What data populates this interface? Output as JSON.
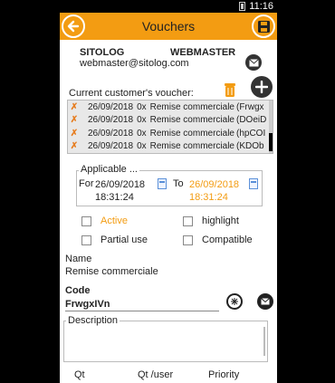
{
  "status": {
    "time": "11:16"
  },
  "header": {
    "title": "Vouchers"
  },
  "user": {
    "company": "SITOLOG",
    "role": "WEBMASTER",
    "email": "webmaster@sitolog.com"
  },
  "vouchers": {
    "label": "Current customer's voucher:",
    "items": [
      {
        "date": "26/09/2018",
        "qty": "0x",
        "name": "Remise commerciale",
        "code": "(Frwgx"
      },
      {
        "date": "26/09/2018",
        "qty": "0x",
        "name": "Remise commerciale",
        "code": "(DOeiD"
      },
      {
        "date": "26/09/2018",
        "qty": "0x",
        "name": "Remise commerciale",
        "code": "(hpCOI"
      },
      {
        "date": "26/09/2018",
        "qty": "0x",
        "name": "Remise commerciale",
        "code": "(KDOb"
      }
    ]
  },
  "applicable": {
    "legend": "Applicable ...",
    "from_label": "For",
    "from_date": "26/09/2018",
    "from_time": "18:31:24",
    "to_label": "To",
    "to_date": "26/09/2018",
    "to_time": "18:31:24"
  },
  "options": {
    "active": "Active",
    "highlight": "highlight",
    "partial_use": "Partial use",
    "compatible": "Compatible"
  },
  "name": {
    "label": "Name",
    "value": "Remise commerciale"
  },
  "code": {
    "label": "Code",
    "value": "FrwgxIVn"
  },
  "description": {
    "label": "Description"
  },
  "footer": {
    "qt": "Qt",
    "qt_user": "Qt /user",
    "priority": "Priority"
  },
  "colors": {
    "accent": "#f39c12",
    "remove": "#e67e22"
  }
}
